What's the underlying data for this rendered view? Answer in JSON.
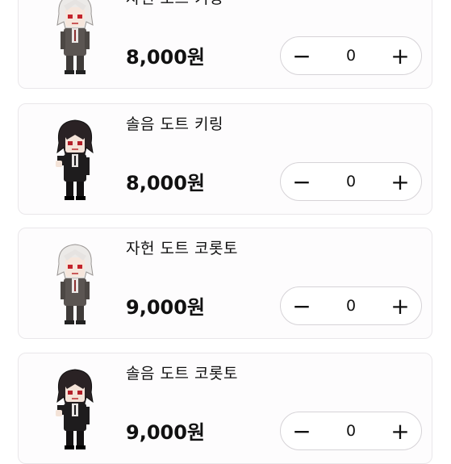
{
  "products": [
    {
      "name": "자헌 도트 키링",
      "price": "8,000원",
      "quantity": "0",
      "character": "white-hair"
    },
    {
      "name": "솔음 도트 키링",
      "price": "8,000원",
      "quantity": "0",
      "character": "black-hair"
    },
    {
      "name": "자헌 도트 코롯토",
      "price": "9,000원",
      "quantity": "0",
      "character": "white-hair"
    },
    {
      "name": "솔음 도트 코롯토",
      "price": "9,000원",
      "quantity": "0",
      "character": "black-hair"
    }
  ],
  "stepper": {
    "minus_symbol": "−",
    "plus_symbol": "+"
  }
}
